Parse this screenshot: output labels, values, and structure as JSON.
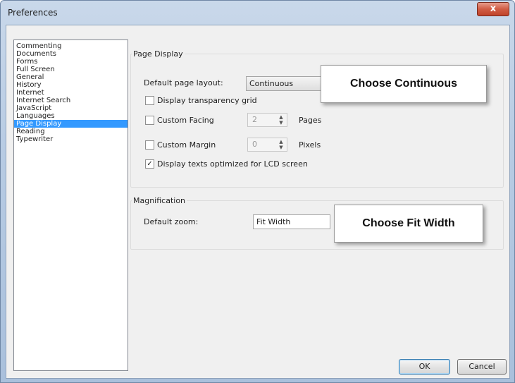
{
  "window": {
    "title": "Preferences",
    "close_glyph": "x"
  },
  "sidebar": {
    "items": [
      {
        "label": "Commenting"
      },
      {
        "label": "Documents"
      },
      {
        "label": "Forms"
      },
      {
        "label": "Full Screen"
      },
      {
        "label": "General"
      },
      {
        "label": "History"
      },
      {
        "label": "Internet"
      },
      {
        "label": "Internet Search"
      },
      {
        "label": "JavaScript"
      },
      {
        "label": "Languages"
      },
      {
        "label": "Page Display",
        "selected": true
      },
      {
        "label": "Reading"
      },
      {
        "label": "Typewriter"
      }
    ]
  },
  "page_display": {
    "group_title": "Page Display",
    "layout_label": "Default page layout:",
    "layout_value": "Continuous",
    "transparency_label": "Display transparency grid",
    "transparency_checked": false,
    "facing_label": "Custom Facing",
    "facing_checked": false,
    "facing_value": "2",
    "facing_unit": "Pages",
    "margin_label": "Custom Margin",
    "margin_checked": false,
    "margin_value": "0",
    "margin_unit": "Pixels",
    "lcd_label": "Display texts optimized for LCD screen",
    "lcd_checked": true,
    "check_glyph": "✓"
  },
  "magnification": {
    "group_title": "Magnification",
    "zoom_label": "Default zoom:",
    "zoom_value": "Fit Width"
  },
  "callouts": {
    "continuous": "Choose Continuous",
    "fit_width": "Choose Fit Width"
  },
  "buttons": {
    "ok": "OK",
    "cancel": "Cancel"
  },
  "colors": {
    "selection": "#3399ff",
    "close_button": "#c0432a"
  }
}
